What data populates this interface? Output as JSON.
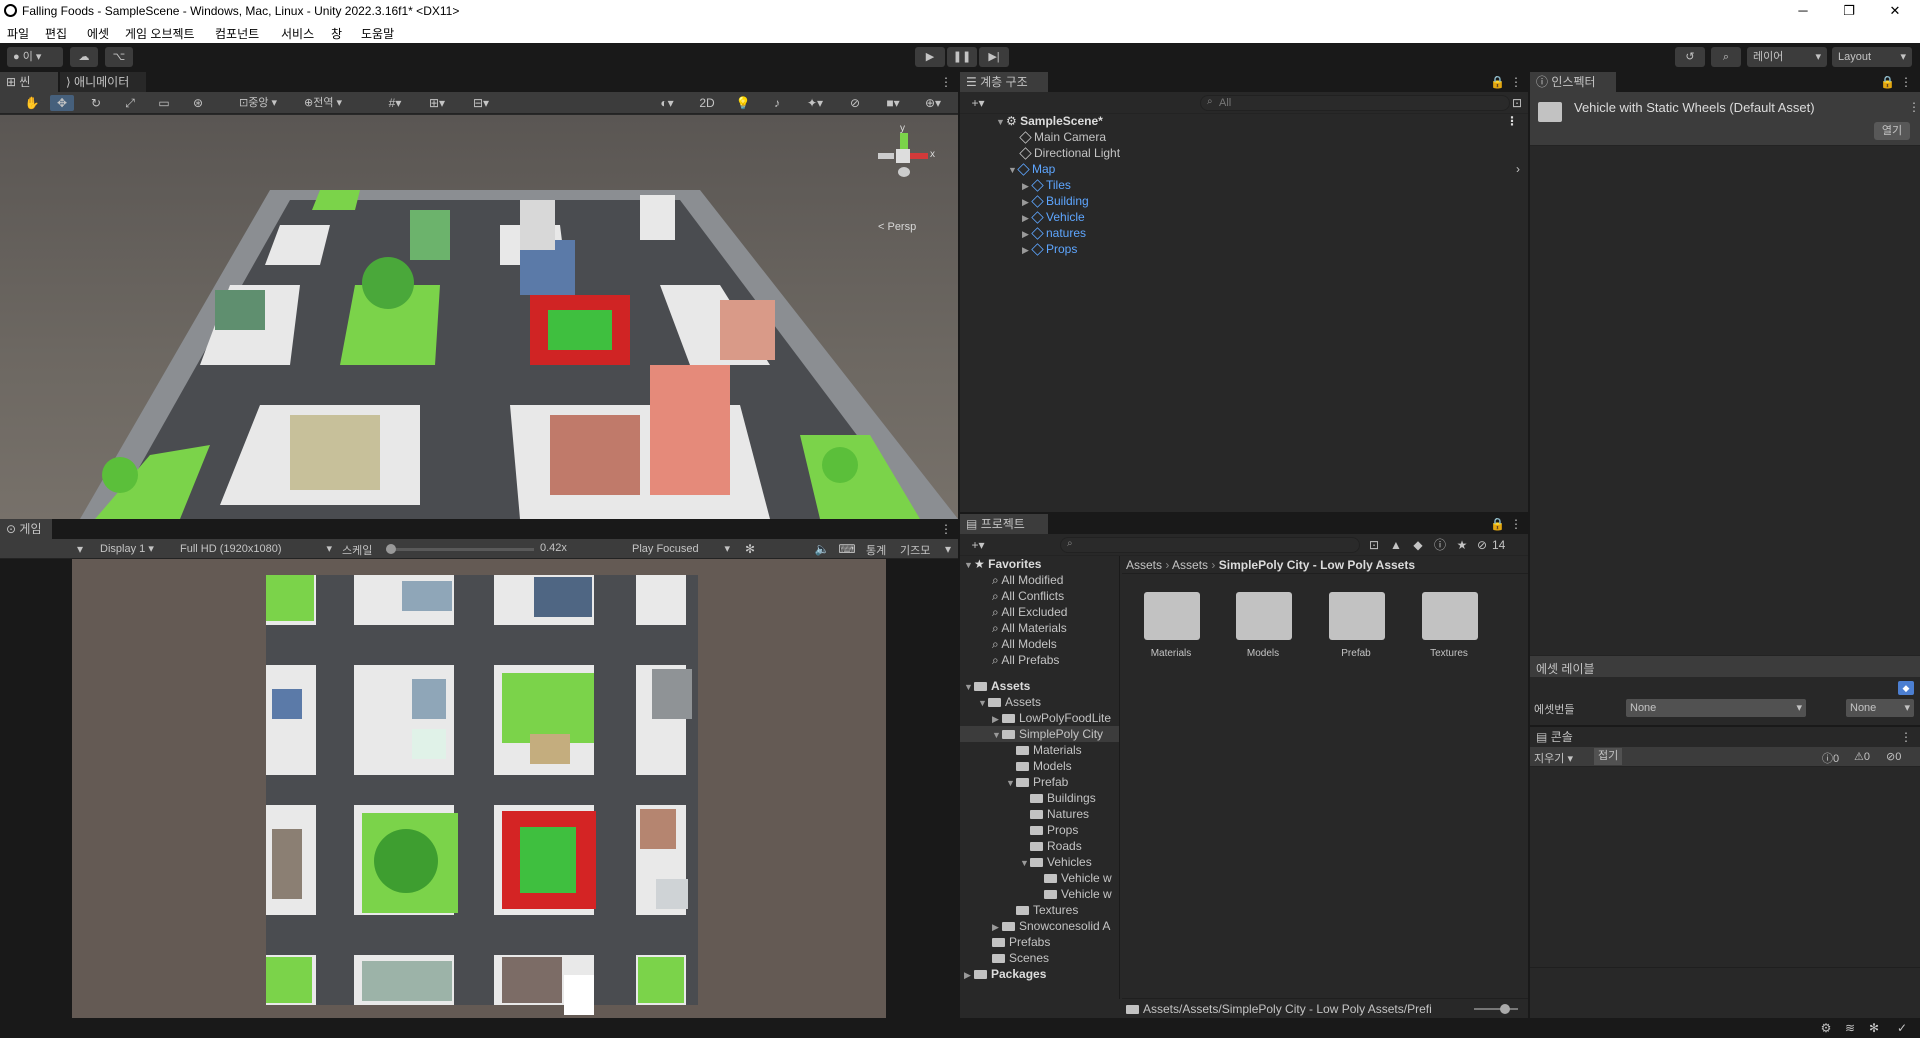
{
  "window": {
    "title": "Falling Foods - SampleScene - Windows, Mac, Linux - Unity 2022.3.16f1* <DX11>",
    "controls": [
      "─",
      "❐",
      "✕"
    ]
  },
  "menu": [
    "파일",
    "편집",
    "에셋",
    "게임 오브젝트",
    "컴포넌트",
    "서비스",
    "창",
    "도움말"
  ],
  "toolbar": {
    "account_label": "이",
    "layers_label": "레이어",
    "layout_label": "Layout"
  },
  "scene": {
    "tabs": [
      "씬",
      "애니메이터"
    ],
    "pivot_label": "중앙",
    "space_label": "전역",
    "mode_2d": "2D",
    "persp_label": "< Persp"
  },
  "game": {
    "tab": "게임",
    "display": "Display 1",
    "resolution": "Full HD (1920x1080)",
    "scale_label": "스케일",
    "scale_value": "0.42x",
    "play_mode": "Play Focused",
    "stats": "통계",
    "gizmos": "기즈모"
  },
  "hierarchy": {
    "tab": "계층 구조",
    "search_placeholder": "All",
    "scene_name": "SampleScene*",
    "items": [
      {
        "label": "Main Camera",
        "blue": false
      },
      {
        "label": "Directional Light",
        "blue": false
      },
      {
        "label": "Map",
        "blue": true
      },
      {
        "label": "Tiles",
        "blue": true
      },
      {
        "label": "Building",
        "blue": true
      },
      {
        "label": "Vehicle",
        "blue": true
      },
      {
        "label": "natures",
        "blue": true
      },
      {
        "label": "Props",
        "blue": true
      }
    ]
  },
  "inspector": {
    "tab": "인스펙터",
    "asset_name": "Vehicle with Static Wheels (Default Asset)",
    "open_button": "열기",
    "asset_labels": "에셋 레이블",
    "asset_bundle_label": "에셋번들",
    "bundle_value": "None",
    "variant_value": "None"
  },
  "console": {
    "tab": "콘솔",
    "clear": "지우기",
    "collapse": "접기",
    "info_count": "0",
    "warn_count": "0",
    "error_count": "0"
  },
  "project": {
    "tab": "프로젝트",
    "hidden_count": "14",
    "favorites_label": "Favorites",
    "favorites": [
      "All Modified",
      "All Conflicts",
      "All Excluded",
      "All Materials",
      "All Models",
      "All Prefabs"
    ],
    "tree": [
      {
        "label": "Assets",
        "bold": true
      },
      {
        "label": "Assets"
      },
      {
        "label": "LowPolyFoodLite"
      },
      {
        "label": "SimplePoly City"
      },
      {
        "label": "Materials"
      },
      {
        "label": "Models"
      },
      {
        "label": "Prefab"
      },
      {
        "label": "Buildings"
      },
      {
        "label": "Natures"
      },
      {
        "label": "Props"
      },
      {
        "label": "Roads"
      },
      {
        "label": "Vehicles"
      },
      {
        "label": "Vehicle w"
      },
      {
        "label": "Vehicle w"
      },
      {
        "label": "Textures"
      },
      {
        "label": "Snowconesolid A"
      },
      {
        "label": "Prefabs"
      },
      {
        "label": "Scenes"
      },
      {
        "label": "Packages",
        "bold": true
      }
    ],
    "breadcrumb": [
      "Assets",
      "Assets",
      "SimplePoly City - Low Poly Assets"
    ],
    "folders": [
      "Materials",
      "Models",
      "Prefab",
      "Textures"
    ],
    "footer_path": "Assets/Assets/SimplePoly City - Low Poly Assets/Prefi"
  },
  "colors": {
    "accent": "#5ea6ff",
    "panel": "#282828",
    "header": "#3c3c3c",
    "grass": "#7bd34a",
    "road": "#4a4c50"
  }
}
